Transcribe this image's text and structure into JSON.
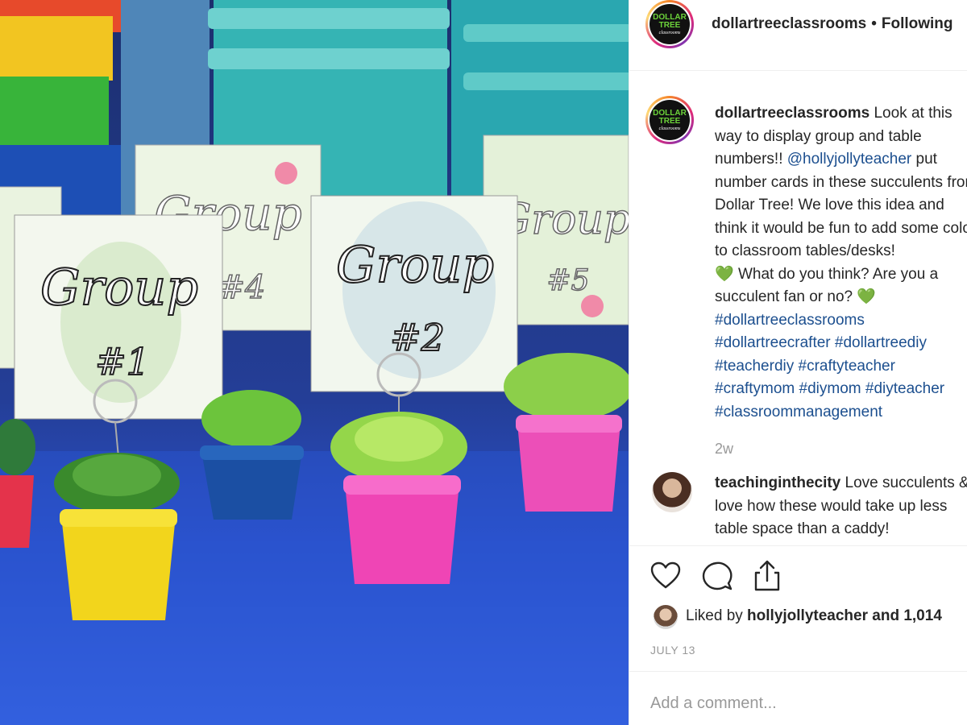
{
  "photo": {
    "cards": [
      {
        "title": "Group",
        "number": "#1"
      },
      {
        "title": "Group",
        "number": "#2"
      },
      {
        "title": "Group",
        "number": "#4"
      },
      {
        "title": "Group",
        "number": "#5"
      }
    ]
  },
  "header": {
    "username": "dollartreeclassrooms",
    "separator": "•",
    "follow_status": "Following",
    "logo": {
      "line1": "DOLLAR",
      "line2": "TREE",
      "line3": "classrooms"
    }
  },
  "caption": {
    "username": "dollartreeclassrooms",
    "text_1": " Look at this way to display group and table numbers!! ",
    "mention": "@hollyjollyteacher",
    "text_2": " put number cards in these succulents from Dollar Tree! We love this idea and think it would be fun to add some color to classroom tables/desks! ",
    "heart": "💚",
    "text_3": " What do you think? Are you a succulent fan or no? ",
    "hashtags_1": "#dollartreeclassrooms",
    "hashtags_2": "#dollartreecrafter",
    "hashtags_3": "#dollartreediy",
    "hashtags_4": "#teacherdiy",
    "hashtags_5": "#craftyteacher",
    "hashtags_6": "#craftymom",
    "hashtags_7": "#diymom",
    "hashtags_8": "#diyteacher",
    "hashtags_9": "#classroommanagement",
    "time": "2w"
  },
  "comment": {
    "username": "teachinginthecity",
    "text": " Love succulents & I love how these would take up less table space than a caddy!"
  },
  "actions": {
    "like_icon": "heart-icon",
    "comment_icon": "speech-bubble-icon",
    "share_icon": "share-icon"
  },
  "likes": {
    "prefix": "Liked by ",
    "user": "hollyjollyteacher",
    "suffix": " and 1,014"
  },
  "date": "JULY 13",
  "add_comment": {
    "placeholder": "Add a comment..."
  }
}
